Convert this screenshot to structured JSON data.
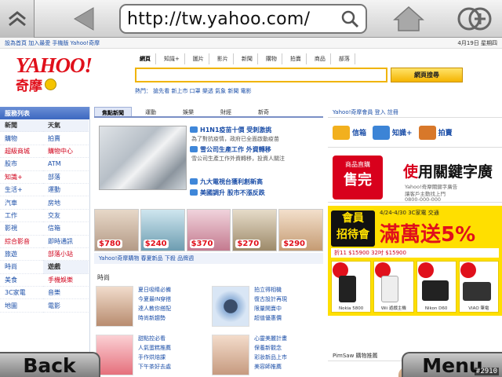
{
  "browser": {
    "url": "http://tw.yahoo.com/"
  },
  "page": {
    "topstrip": {
      "left": "設為首頁  加入最愛  手機版  Yahoo!奇摩",
      "right": "4月19日 星期四"
    },
    "logo": {
      "word": "YAHOO!",
      "cn": "奇摩"
    },
    "search": {
      "tabs": [
        "網頁",
        "知識+",
        "圖片",
        "影片",
        "新聞",
        "購物",
        "拍賣",
        "商品",
        "部落"
      ],
      "button": "網頁搜尋",
      "hot": "熱門：  搶先看  新上市  口罩  樂透  氣象  新聞  電影"
    },
    "sidebar": {
      "title": "服務列表",
      "items": [
        {
          "label": "新聞",
          "style": "cat"
        },
        {
          "label": "天氣",
          "style": "cat"
        },
        {
          "label": "購物",
          "style": ""
        },
        {
          "label": "拍賣",
          "style": ""
        },
        {
          "label": "超級商城",
          "style": "red"
        },
        {
          "label": "購物中心",
          "style": "red"
        },
        {
          "label": "股市",
          "style": ""
        },
        {
          "label": "ATM",
          "style": ""
        },
        {
          "label": "知識+",
          "style": "red"
        },
        {
          "label": "部落",
          "style": ""
        },
        {
          "label": "生活+",
          "style": ""
        },
        {
          "label": "運動",
          "style": ""
        },
        {
          "label": "汽車",
          "style": ""
        },
        {
          "label": "房地",
          "style": ""
        },
        {
          "label": "工作",
          "style": ""
        },
        {
          "label": "交友",
          "style": ""
        },
        {
          "label": "影視",
          "style": ""
        },
        {
          "label": "信箱",
          "style": ""
        },
        {
          "label": "綜合影音",
          "style": "red"
        },
        {
          "label": "即時通訊",
          "style": ""
        },
        {
          "label": "旅遊",
          "style": ""
        },
        {
          "label": "部落小站",
          "style": "red"
        },
        {
          "label": "時尚",
          "style": ""
        },
        {
          "label": "遊戲",
          "style": "cat"
        },
        {
          "label": "美食",
          "style": ""
        },
        {
          "label": "手機娛樂",
          "style": "red"
        },
        {
          "label": "3C家電",
          "style": ""
        },
        {
          "label": "音樂",
          "style": ""
        },
        {
          "label": "地圖",
          "style": ""
        },
        {
          "label": "電影",
          "style": ""
        }
      ]
    },
    "news": {
      "tabs": [
        "焦點新聞",
        "運動",
        "娛樂",
        "財經",
        "新奇"
      ],
      "items": [
        {
          "head": "H1N1疫苗十價 受刺激挑",
          "sub": "為了對抗疫情，政府已全面啟動疫苗"
        },
        {
          "head": "雪公司生產工作 外資轉移",
          "sub": "雪公司生產工作外資轉移，投資人關注"
        },
        {
          "head": "九大電視台獲利創新高",
          "sub": ""
        },
        {
          "head": "美國調升 股市不漲反跌",
          "sub": ""
        }
      ]
    },
    "promos": [
      {
        "price": "$780"
      },
      {
        "price": "$240"
      },
      {
        "price": "$370"
      },
      {
        "price": "$270"
      },
      {
        "price": "$290"
      }
    ],
    "promo_links": "Yahoo!奇摩購物  春夏新品  下殺  品牌週",
    "fashion_label": "時尚",
    "features": [
      {
        "lines": [
          "夏日吸睛必備",
          "今夏最IN穿搭",
          "達人教你搭配",
          "時尚新趨勢"
        ]
      },
      {
        "lines": [
          "拍立得相機",
          "復古設計再現",
          "限量開賣中",
          "超值優惠價"
        ]
      },
      {
        "lines": [
          "甜點控必看",
          "人氣蛋糕推薦",
          "手作烘焙課",
          "下午茶好去處"
        ]
      },
      {
        "lines": [
          "心靈美麗計畫",
          "保養新觀念",
          "彩妝新品上市",
          "美容師推薦"
        ]
      }
    ],
    "member": {
      "bar": "Yahoo!奇摩會員  登入  註冊",
      "icons": [
        {
          "label": "信箱",
          "color": "#f2b01e"
        },
        {
          "label": "知識+",
          "color": "#3c84d6"
        },
        {
          "label": "拍賣",
          "color": "#d8782a"
        }
      ]
    },
    "ad1": {
      "tag_a": "商品直購",
      "tag_b": "售完",
      "title_red": "使",
      "title": "用關鍵字廣",
      "sub": [
        "Yahoo!奇摩關鍵字廣告",
        "讓客戶主動找上門",
        "0800-000-000"
      ]
    },
    "ad2": {
      "left": [
        "會員",
        "招待會"
      ],
      "date": "4/24-4/30  3C家電  交通",
      "title": "滿萬送5%",
      "row": "折11  $15900  32吋  $15900",
      "products": [
        "Nokia 5800",
        "Wii 遊戲主機",
        "Nikon D60",
        "VIAO 筆電"
      ]
    },
    "fan_bar": "PimSaw 購物推薦"
  },
  "softkeys": {
    "back": "Back",
    "menu": "Menu"
  },
  "frame_id": "#2910"
}
